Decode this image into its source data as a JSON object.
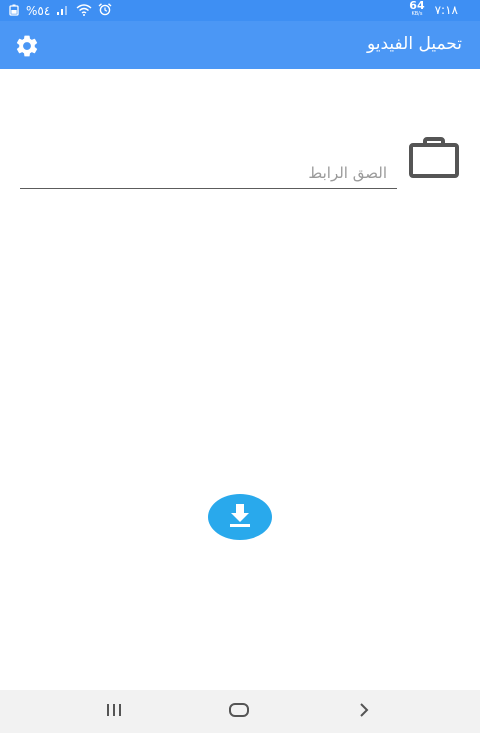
{
  "status_bar": {
    "time": "٧:١٨",
    "network_speed_value": "64",
    "network_speed_unit": "KB/s",
    "battery_percent": "%٥٤",
    "icons": [
      "alarm-icon",
      "wifi-icon",
      "signal-icon",
      "battery-icon"
    ]
  },
  "app_bar": {
    "title": "تحميل الفيديو",
    "settings_icon": "gear-icon",
    "color": "#4b97f5"
  },
  "url_input": {
    "placeholder": "الصق الرابط",
    "value": ""
  },
  "clipboard": {
    "icon": "clipboard-icon"
  },
  "download": {
    "icon": "download-icon",
    "color": "#29a9ec"
  },
  "nav_bar": {
    "items": [
      "recents-icon",
      "home-icon",
      "back-icon"
    ]
  }
}
